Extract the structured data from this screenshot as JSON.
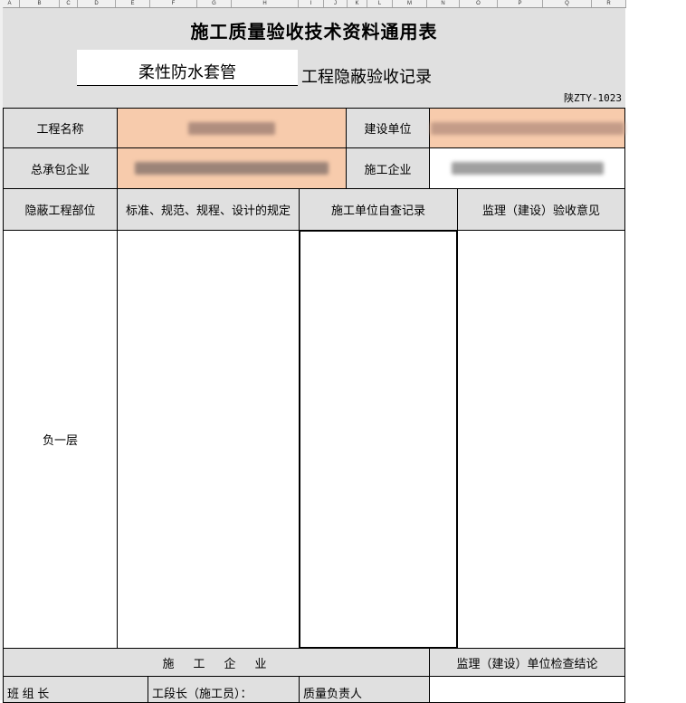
{
  "columns": [
    "A",
    "B",
    "C",
    "D",
    "E",
    "F",
    "G",
    "H",
    "I",
    "J",
    "K",
    "L",
    "M",
    "N",
    "O",
    "P",
    "Q",
    "R"
  ],
  "form": {
    "title": "施工质量验收技术资料通用表",
    "subject": "柔性防水套管",
    "subject_suffix": "工程隐蔽验收记录",
    "code": "陕ZTY-1023"
  },
  "info": {
    "project_name_label": "工程名称",
    "construction_unit_label": "建设单位",
    "general_contractor_label": "总承包企业",
    "builder_label": "施工企业"
  },
  "headers": {
    "location": "隐蔽工程部位",
    "standards": "标准、规范、规程、设计的规定",
    "self_check": "施工单位自查记录",
    "supervision": "监理（建设）验收意见"
  },
  "body": {
    "location_value": "负一层"
  },
  "footer": {
    "builder_section": "施　工　企　业",
    "supervision_conclusion": "监理（建设）单位检查结论",
    "team_leader": "班 组 长",
    "section_chief": "工段长（施工员）：",
    "quality_manager": "质量负责人"
  },
  "colors": {
    "header_gray": "#e0e0e0",
    "highlight_peach": "#f7cbac",
    "redaction": "#8c8c8c"
  }
}
